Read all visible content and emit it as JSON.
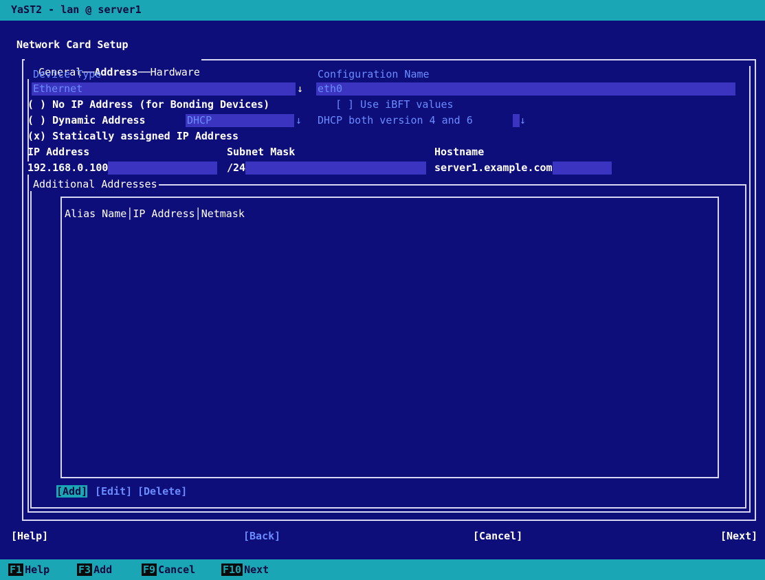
{
  "window_title": "YaST2 - lan @ server1",
  "dialog": {
    "title": "Network Card Setup",
    "tabs": [
      "General",
      "Address",
      "Hardware"
    ],
    "device_type_label": "Device Type",
    "device_type_value": "Ethernet",
    "config_name_label": "Configuration Name",
    "config_name_value": "eth0",
    "arrow_glyph": "↓",
    "no_ip_option": "( ) No IP Address (for Bonding Devices)",
    "ibft_option": "[ ] Use iBFT values",
    "dynamic_option": "( ) Dynamic Address",
    "dhcp_value": "DHCP",
    "dhcp_version_value": "DHCP both version 4 and 6",
    "static_option": "(x) Statically assigned IP Address",
    "ip_label": "IP Address",
    "ip_value": "192.168.0.100",
    "subnet_label": "Subnet Mask",
    "subnet_value": "/24",
    "hostname_label": "Hostname",
    "hostname_value": "server1.example.com",
    "additional_label": "Additional Addresses",
    "table_columns": [
      "Alias Name",
      "IP Address",
      "Netmask"
    ],
    "table_buttons": {
      "add": "[Add]",
      "edit": "[Edit]",
      "delete": "[Delete]"
    }
  },
  "buttons": {
    "help": "[Help]",
    "back": "[Back]",
    "cancel": "[Cancel]",
    "next": "[Next]"
  },
  "fkeys": [
    {
      "key": "F1",
      "label": "Help"
    },
    {
      "key": "F3",
      "label": "Add"
    },
    {
      "key": "F9",
      "label": "Cancel"
    },
    {
      "key": "F10",
      "label": "Next"
    }
  ],
  "colors": {
    "background": "#0e0e7a",
    "bar": "#1aa6b4",
    "field": "#3a34c0",
    "dim_text": "#6a8cff"
  }
}
